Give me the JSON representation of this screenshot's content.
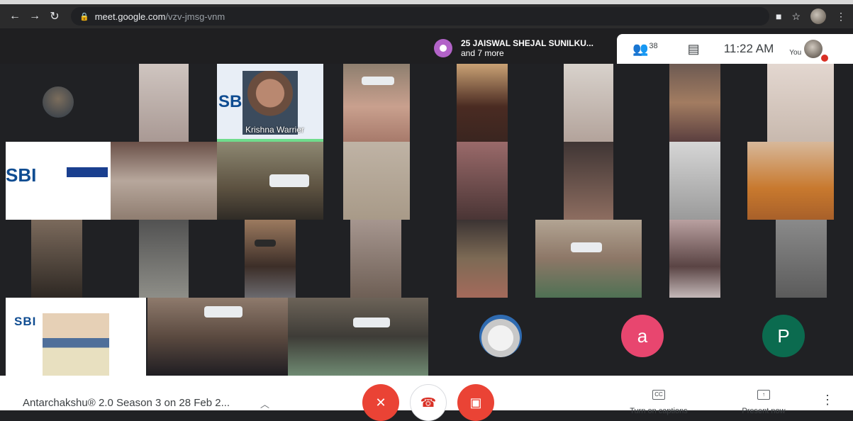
{
  "browser": {
    "url_host": "meet.google.com",
    "url_path": "/vzv-jmsg-vnm",
    "back_icon": "arrow-left-icon",
    "forward_icon": "arrow-right-icon",
    "reload_icon": "reload-icon"
  },
  "meet_top": {
    "presenter_line1": "25 JAISWAL SHEJAL SUNILKU...",
    "presenter_line2": "and 7 more",
    "participant_count": "38",
    "time": "11:22 AM",
    "you_label": "You"
  },
  "tiles": {
    "speaker_name": "Krishna Warrier",
    "sbi_label": "SBI",
    "avatar_a": "a",
    "avatar_p": "P",
    "colors": {
      "avatar_a": "#e8466f",
      "avatar_p": "#0b6b4f"
    }
  },
  "bottom": {
    "meeting_title": "Antarchakshu® 2.0 Season 3 on 28 Feb 2...",
    "captions_label": "Turn on captions",
    "present_label": "Present now",
    "cc_icon_text": "CC"
  }
}
